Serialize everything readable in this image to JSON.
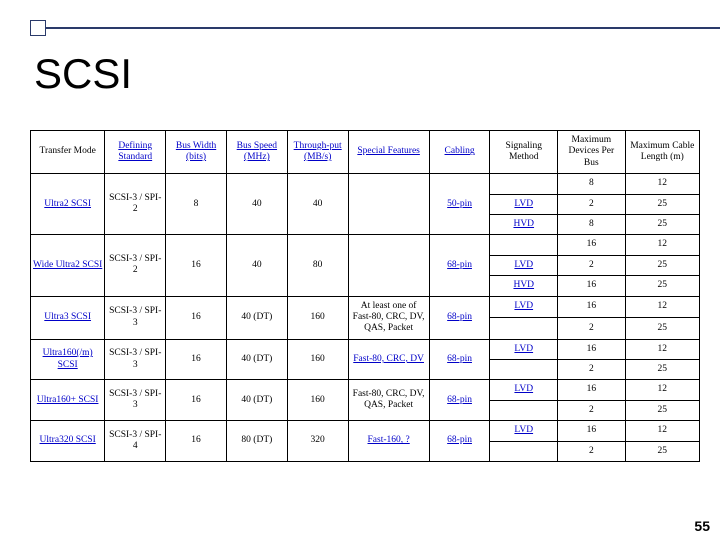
{
  "title": "SCSI",
  "page_number": "55",
  "headers": [
    "Transfer Mode",
    "Defining Standard",
    "Bus Width (bits)",
    "Bus Speed (MHz)",
    "Through-put (MB/s)",
    "Special Features",
    "Cabling",
    "Signaling Method",
    "Maximum Devices Per Bus",
    "Maximum Cable Length (m)"
  ],
  "chart_data": {
    "type": "table",
    "modes": [
      {
        "name": "Ultra2 SCSI",
        "name_link": true,
        "standard": "SCSI-3 / SPI-2",
        "bus_width": "8",
        "bus_speed": "40",
        "throughput": "40",
        "features": "",
        "features_link": false,
        "cabling": "50-pin",
        "cabling_link": true,
        "signaling": [
          {
            "method": "",
            "method_link": false,
            "max_dev": "8",
            "max_len": "12"
          },
          {
            "method": "LVD",
            "method_link": true,
            "max_dev": "2",
            "max_len": "25"
          },
          {
            "method": "HVD",
            "method_link": true,
            "max_dev": "8",
            "max_len": "25"
          }
        ]
      },
      {
        "name": "Wide Ultra2 SCSI",
        "name_link": true,
        "standard": "SCSI-3 / SPI-2",
        "bus_width": "16",
        "bus_speed": "40",
        "throughput": "80",
        "features": "",
        "features_link": false,
        "cabling": "68-pin",
        "cabling_link": true,
        "signaling": [
          {
            "method": "",
            "method_link": false,
            "max_dev": "16",
            "max_len": "12"
          },
          {
            "method": "LVD",
            "method_link": true,
            "max_dev": "2",
            "max_len": "25"
          },
          {
            "method": "HVD",
            "method_link": true,
            "max_dev": "16",
            "max_len": "25"
          }
        ]
      },
      {
        "name": "Ultra3 SCSI",
        "name_link": true,
        "standard": "SCSI-3 / SPI-3",
        "bus_width": "16",
        "bus_speed": "40 (DT)",
        "throughput": "160",
        "features": "At least one of Fast-80, CRC, DV, QAS, Packet",
        "features_link": false,
        "cabling": "68-pin",
        "cabling_link": true,
        "signaling": [
          {
            "method": "LVD",
            "method_link": true,
            "max_dev": "16",
            "max_len": "12"
          },
          {
            "method": "",
            "method_link": false,
            "max_dev": "2",
            "max_len": "25"
          }
        ]
      },
      {
        "name": "Ultra160(/m) SCSI",
        "name_link": true,
        "standard": "SCSI-3 / SPI-3",
        "bus_width": "16",
        "bus_speed": "40 (DT)",
        "throughput": "160",
        "features": "Fast-80, CRC, DV",
        "features_link": true,
        "cabling": "68-pin",
        "cabling_link": true,
        "signaling": [
          {
            "method": "LVD",
            "method_link": true,
            "max_dev": "16",
            "max_len": "12"
          },
          {
            "method": "",
            "method_link": false,
            "max_dev": "2",
            "max_len": "25"
          }
        ]
      },
      {
        "name": "Ultra160+ SCSI",
        "name_link": true,
        "standard": "SCSI-3 / SPI-3",
        "bus_width": "16",
        "bus_speed": "40 (DT)",
        "throughput": "160",
        "features": "Fast-80, CRC, DV, QAS, Packet",
        "features_link": false,
        "cabling": "68-pin",
        "cabling_link": true,
        "signaling": [
          {
            "method": "LVD",
            "method_link": true,
            "max_dev": "16",
            "max_len": "12"
          },
          {
            "method": "",
            "method_link": false,
            "max_dev": "2",
            "max_len": "25"
          }
        ]
      },
      {
        "name": "Ultra320 SCSI",
        "name_link": true,
        "standard": "SCSI-3 / SPI-4",
        "bus_width": "16",
        "bus_speed": "80 (DT)",
        "throughput": "320",
        "features": "Fast-160, ?",
        "features_link": true,
        "cabling": "68-pin",
        "cabling_link": true,
        "signaling": [
          {
            "method": "LVD",
            "method_link": true,
            "max_dev": "16",
            "max_len": "12"
          },
          {
            "method": "",
            "method_link": false,
            "max_dev": "2",
            "max_len": "25"
          }
        ]
      }
    ]
  }
}
